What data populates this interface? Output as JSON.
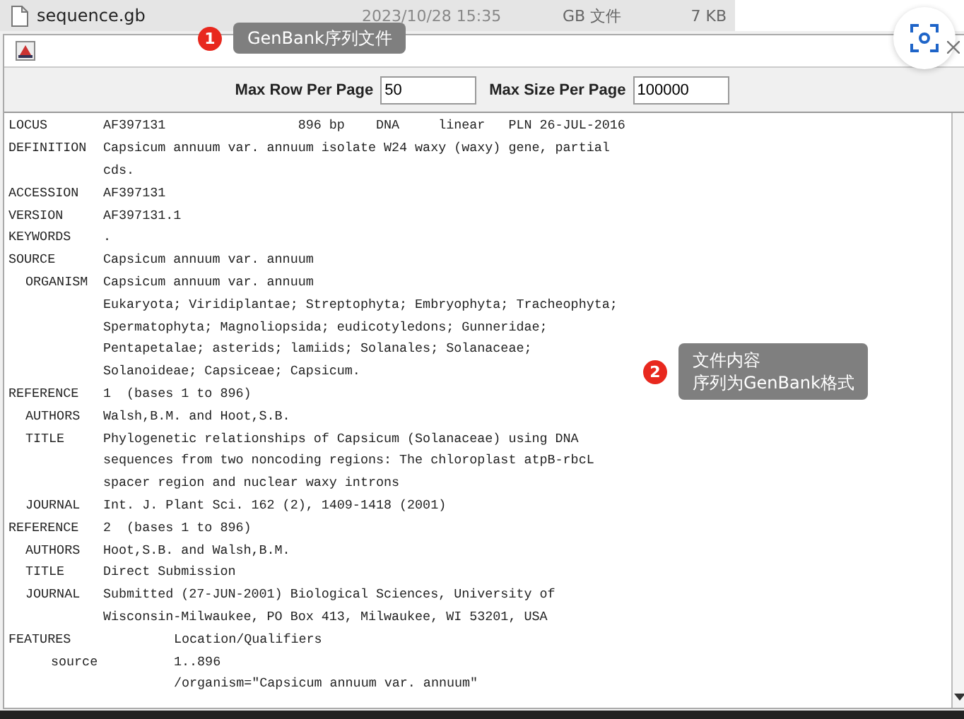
{
  "file_row": {
    "name": "sequence.gb",
    "date": "2023/10/28 15:35",
    "type": "GB 文件",
    "size": "7 KB"
  },
  "toolbar": {
    "fields": [
      {
        "label": "Max Row Per Page",
        "value": "50"
      },
      {
        "label": "Max Size Per Page",
        "value": "100000"
      }
    ]
  },
  "records": [
    {
      "key": "LOCUS",
      "lines": [
        "AF397131                 896 bp    DNA     linear   PLN 26-JUL-2016"
      ]
    },
    {
      "key": "DEFINITION",
      "lines": [
        "Capsicum annuum var. annuum isolate W24 waxy (waxy) gene, partial",
        "cds."
      ]
    },
    {
      "key": "ACCESSION",
      "lines": [
        "AF397131"
      ]
    },
    {
      "key": "VERSION",
      "lines": [
        "AF397131.1"
      ]
    },
    {
      "key": "KEYWORDS",
      "lines": [
        "."
      ]
    },
    {
      "key": "SOURCE",
      "lines": [
        "Capsicum annuum var. annuum"
      ],
      "children": [
        {
          "key": "ORGANISM",
          "lines": [
            "Capsicum annuum var. annuum",
            "Eukaryota; Viridiplantae; Streptophyta; Embryophyta; Tracheophyta;",
            "Spermatophyta; Magnoliopsida; eudicotyledons; Gunneridae;",
            "Pentapetalae; asterids; lamiids; Solanales; Solanaceae;",
            "Solanoideae; Capsiceae; Capsicum."
          ]
        }
      ]
    },
    {
      "key": "REFERENCE",
      "lines": [
        "1  (bases 1 to 896)"
      ],
      "children": [
        {
          "key": "AUTHORS",
          "lines": [
            "Walsh,B.M. and Hoot,S.B."
          ]
        },
        {
          "key": "TITLE",
          "lines": [
            "Phylogenetic relationships of Capsicum (Solanaceae) using DNA",
            "sequences from two noncoding regions: The chloroplast atpB-rbcL",
            "spacer region and nuclear waxy introns"
          ]
        },
        {
          "key": "JOURNAL",
          "lines": [
            "Int. J. Plant Sci. 162 (2), 1409-1418 (2001)"
          ]
        }
      ]
    },
    {
      "key": "REFERENCE",
      "lines": [
        "2  (bases 1 to 896)"
      ],
      "children": [
        {
          "key": "AUTHORS",
          "lines": [
            "Hoot,S.B. and Walsh,B.M."
          ]
        },
        {
          "key": "TITLE",
          "lines": [
            "Direct Submission"
          ]
        },
        {
          "key": "JOURNAL",
          "lines": [
            "Submitted (27-JUN-2001) Biological Sciences, University of",
            "Wisconsin-Milwaukee, PO Box 413, Milwaukee, WI 53201, USA"
          ]
        }
      ]
    }
  ],
  "features": {
    "key": "FEATURES",
    "header": "Location/Qualifiers",
    "items": [
      {
        "key": "source",
        "lines": [
          "1..896",
          "/organism=\"Capsicum annuum var. annuum\""
        ]
      }
    ]
  },
  "callouts": [
    {
      "number": "1",
      "lines": [
        "GenBank序列文件"
      ]
    },
    {
      "number": "2",
      "lines": [
        "文件内容",
        "序列为GenBank格式"
      ]
    }
  ]
}
